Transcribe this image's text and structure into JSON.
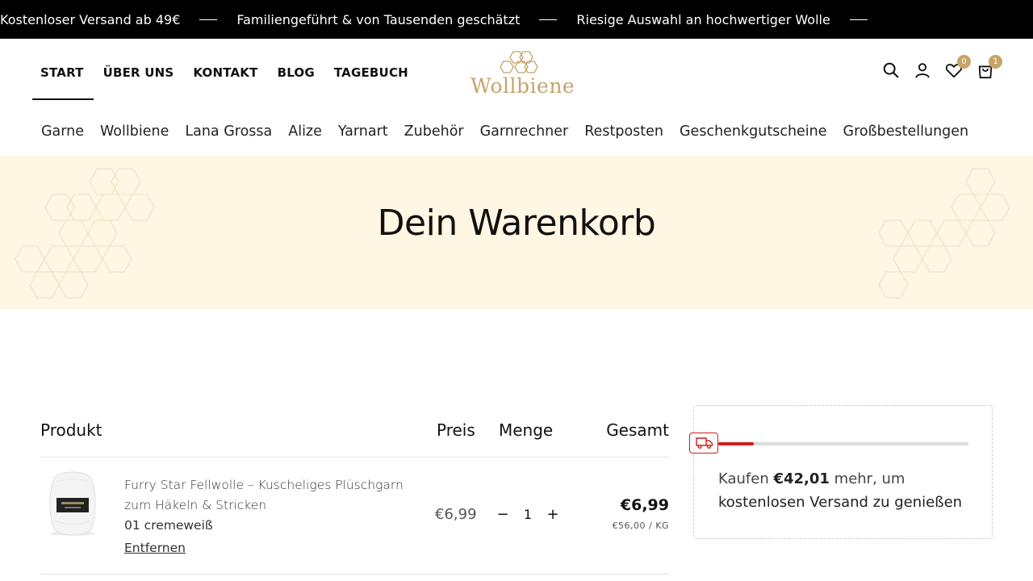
{
  "announcement": {
    "messages": [
      "Kostenloser Versand ab 49€",
      "Familiengeführt & von Tausenden geschätzt",
      "Riesige Auswahl an hochwertiger Wolle"
    ]
  },
  "header": {
    "top_nav": [
      {
        "label": "START",
        "active": true
      },
      {
        "label": "ÜBER UNS",
        "active": false
      },
      {
        "label": "KONTAKT",
        "active": false
      },
      {
        "label": "BLOG",
        "active": false
      },
      {
        "label": "TAGEBUCH",
        "active": false
      }
    ],
    "logo_text": "Wollbiene",
    "icons": {
      "search": "search-icon",
      "account": "user-icon",
      "wishlist": "heart-icon",
      "wishlist_count": "0",
      "cart": "bag-icon",
      "cart_count": "1"
    },
    "main_nav": [
      "Garne",
      "Wollbiene",
      "Lana Grossa",
      "Alize",
      "Yarnart",
      "Zubehör",
      "Garnrechner",
      "Restposten",
      "Geschenkgutscheine",
      "Großbestellungen"
    ]
  },
  "hero": {
    "title": "Dein Warenkorb"
  },
  "cart": {
    "headers": {
      "product": "Produkt",
      "price": "Preis",
      "quantity": "Menge",
      "total": "Gesamt"
    },
    "items": [
      {
        "name": "Furry Star Fellwolle – Kuscheliges Plüschgarn zum Häkeln & Stricken",
        "variant": "01 cremeweiß",
        "remove_label": "Entfernen",
        "price": "€6,99",
        "quantity": "1",
        "decrement": "−",
        "increment": "+",
        "total": "€6,99",
        "unit_price": "€56,00 / KG"
      }
    ]
  },
  "shipping": {
    "progress": 0.143,
    "prefix": "Kaufen ",
    "amount": "€42,01",
    "middle": " mehr, um",
    "suffix": "kostenlosen Versand zu genießen",
    "colors": {
      "accent": "#d01b1b"
    }
  },
  "colors": {
    "brand": "#c8a366",
    "hero_bg": "#fff6e3"
  }
}
